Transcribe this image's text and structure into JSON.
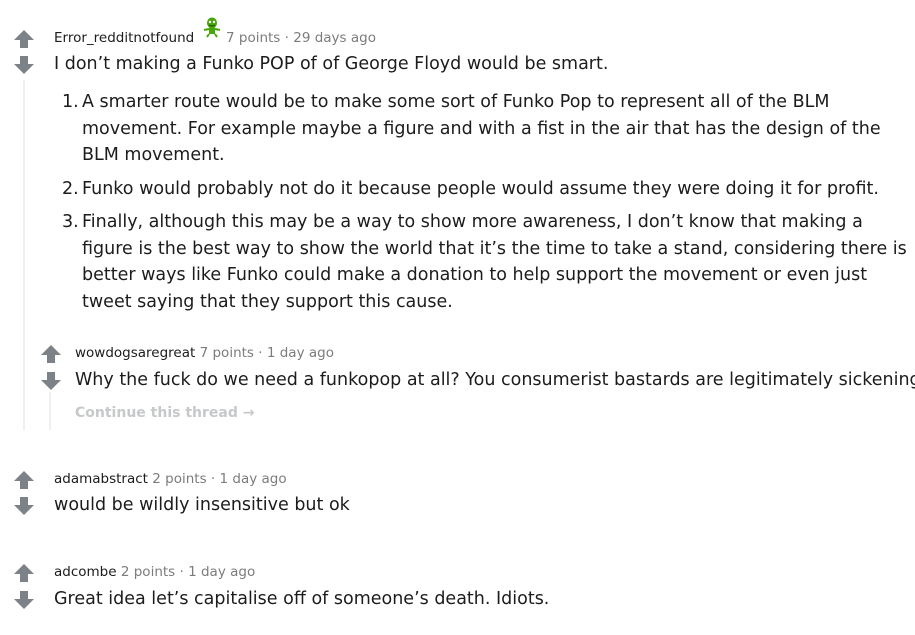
{
  "colors": {
    "arrow": "#7c8288",
    "meta_gray": "#7c7c7c",
    "text": "#1c1c1c",
    "continue": "#c6c8ca",
    "thread_line": "#edeff1",
    "flair_green": "#46a508"
  },
  "icons": {
    "upvote": "upvote-arrow-icon",
    "downvote": "downvote-arrow-icon",
    "flair": "troll-flair-icon",
    "continue_arrow": "arrow-right-icon"
  },
  "comments": [
    {
      "author": "Error_redditnotfound",
      "score": "7 points",
      "separator": "·",
      "time": "29 days ago",
      "body": "I don’t making a Funko POP of of George Floyd would be smart.",
      "list": [
        {
          "num": "1.",
          "lines": [
            "A smarter route would be to make some sort of Funko Pop to represent all of the BLM",
            "movement. For example maybe a figure and with a fist in the air that has the design of the",
            "BLM movement."
          ]
        },
        {
          "num": "2.",
          "lines": [
            "Funko would probably not do it because people would assume they were doing it for profit."
          ]
        },
        {
          "num": "3.",
          "lines": [
            "Finally, although this may be a way to show more awareness, I don’t know that making a",
            "figure is the best way to show the world that it’s the time to take a stand, considering there is",
            "better ways like Funko could make a donation to help support the movement or even just",
            "tweet saying that they support this cause."
          ]
        }
      ],
      "reply": {
        "author": "wowdogsaregreat",
        "score": "7 points",
        "separator": "·",
        "time": "1 day ago",
        "body": "Why the fuck do we need a funkopop at all? You consumerist bastards are legitimately sickening.",
        "continue_label": "Continue this thread",
        "continue_arrow": "→"
      }
    },
    {
      "author": "adamabstract",
      "score": "2 points",
      "separator": "·",
      "time": "1 day ago",
      "body": "would be wildly insensitive but ok"
    },
    {
      "author": "adcombe",
      "score": "2 points",
      "separator": "·",
      "time": "1 day ago",
      "body": "Great idea let’s capitalise off of someone’s death. Idiots."
    }
  ]
}
